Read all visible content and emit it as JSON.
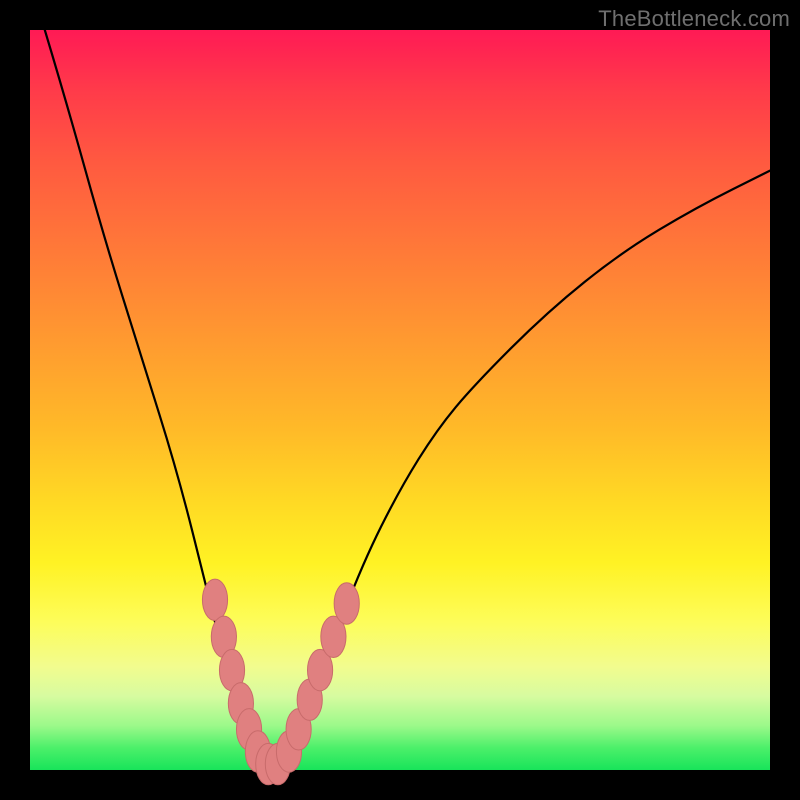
{
  "watermark": "TheBottleneck.com",
  "colors": {
    "frame": "#000000",
    "curve_stroke": "#000000",
    "marker_fill": "#e08080",
    "marker_stroke": "#c86b6b"
  },
  "chart_data": {
    "type": "line",
    "title": "",
    "xlabel": "",
    "ylabel": "",
    "xlim": [
      0,
      100
    ],
    "ylim": [
      0,
      100
    ],
    "grid": false,
    "legend": false,
    "series": [
      {
        "name": "bottleneck-curve",
        "x": [
          2,
          5,
          10,
          15,
          20,
          24,
          26,
          28,
          30,
          31.5,
          33,
          34.5,
          36,
          38,
          40,
          45,
          50,
          55,
          60,
          70,
          80,
          90,
          100
        ],
        "values": [
          100,
          90,
          72,
          56,
          40,
          24,
          16,
          9,
          4,
          1.5,
          0.5,
          1.5,
          4,
          9,
          15,
          28,
          38,
          46,
          52,
          62,
          70,
          76,
          81
        ]
      }
    ],
    "markers": [
      {
        "x": 25.0,
        "y": 23.0
      },
      {
        "x": 26.2,
        "y": 18.0
      },
      {
        "x": 27.3,
        "y": 13.5
      },
      {
        "x": 28.5,
        "y": 9.0
      },
      {
        "x": 29.6,
        "y": 5.5
      },
      {
        "x": 30.8,
        "y": 2.5
      },
      {
        "x": 32.2,
        "y": 0.8
      },
      {
        "x": 33.5,
        "y": 0.8
      },
      {
        "x": 35.0,
        "y": 2.5
      },
      {
        "x": 36.3,
        "y": 5.5
      },
      {
        "x": 37.8,
        "y": 9.5
      },
      {
        "x": 39.2,
        "y": 13.5
      },
      {
        "x": 41.0,
        "y": 18.0
      },
      {
        "x": 42.8,
        "y": 22.5
      }
    ],
    "marker_rx": 1.7,
    "marker_ry": 2.8
  }
}
